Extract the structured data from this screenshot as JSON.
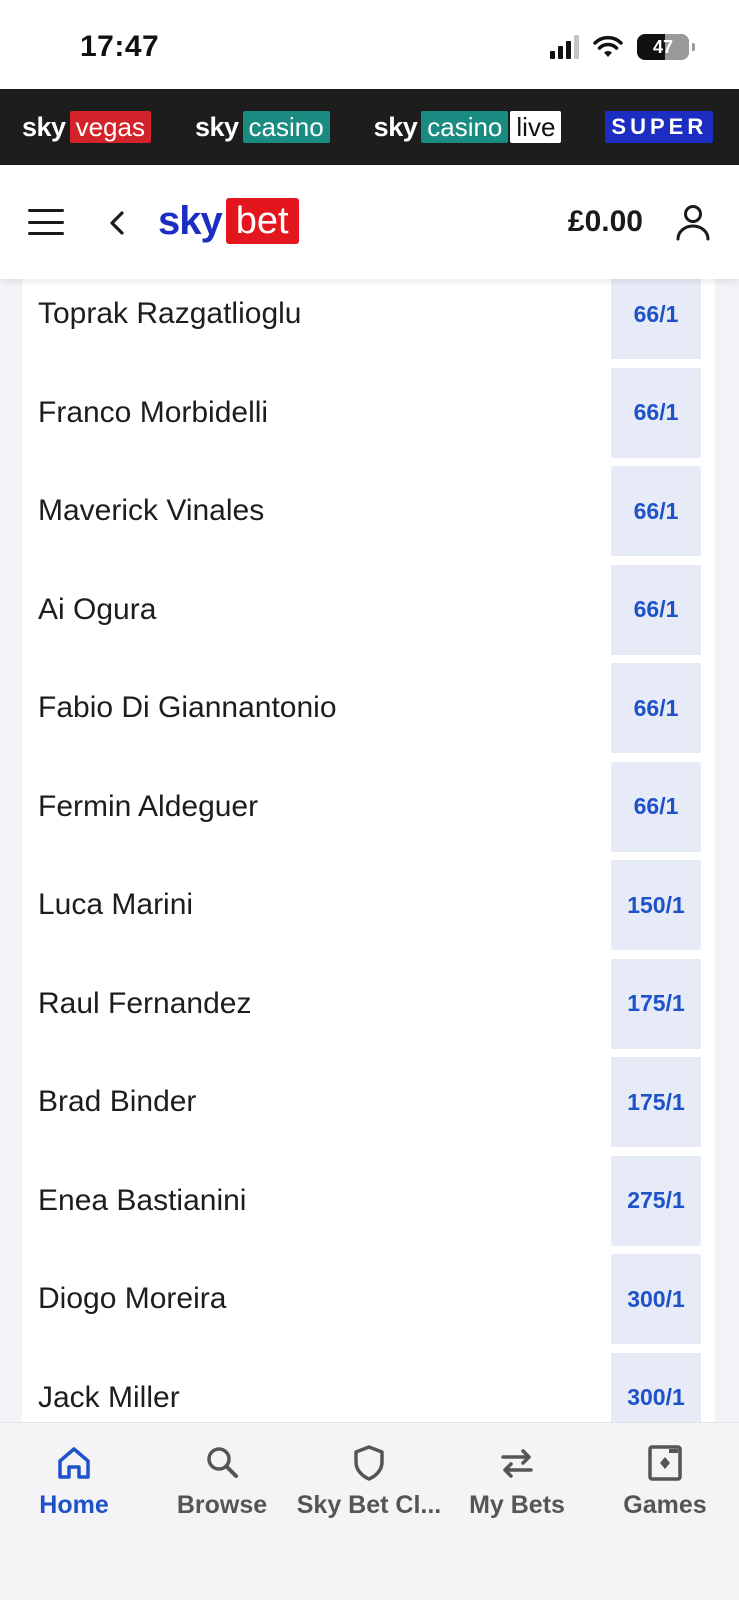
{
  "status_bar": {
    "time": "17:47",
    "battery": "47"
  },
  "brand_strip": {
    "items": [
      {
        "sky": "sky",
        "tag": "vegas"
      },
      {
        "sky": "sky",
        "tag": "casino"
      },
      {
        "sky": "sky",
        "tag": "casino",
        "extra": "live"
      },
      {
        "tag": "SUPER"
      }
    ]
  },
  "header": {
    "logo_sky": "sky",
    "logo_bet": "bet",
    "balance": "£0.00"
  },
  "runners": [
    {
      "name": "Toprak Razgatlioglu",
      "odds": "66/1"
    },
    {
      "name": "Franco Morbidelli",
      "odds": "66/1"
    },
    {
      "name": "Maverick Vinales",
      "odds": "66/1"
    },
    {
      "name": "Ai Ogura",
      "odds": "66/1"
    },
    {
      "name": "Fabio Di Giannantonio",
      "odds": "66/1"
    },
    {
      "name": "Fermin Aldeguer",
      "odds": "66/1"
    },
    {
      "name": "Luca Marini",
      "odds": "150/1"
    },
    {
      "name": "Raul Fernandez",
      "odds": "175/1"
    },
    {
      "name": "Brad Binder",
      "odds": "175/1"
    },
    {
      "name": "Enea Bastianini",
      "odds": "275/1"
    },
    {
      "name": "Diogo Moreira",
      "odds": "300/1"
    },
    {
      "name": "Jack Miller",
      "odds": "300/1"
    }
  ],
  "bottom_nav": {
    "items": [
      {
        "label": "Home",
        "icon": "home-icon",
        "active": true
      },
      {
        "label": "Browse",
        "icon": "search-icon",
        "active": false
      },
      {
        "label": "Sky Bet Cl...",
        "icon": "shield-icon",
        "active": false
      },
      {
        "label": "My Bets",
        "icon": "swap-arrows-icon",
        "active": false
      },
      {
        "label": "Games",
        "icon": "games-card-icon",
        "active": false
      }
    ]
  },
  "colors": {
    "accent_blue": "#1e52c8",
    "odds_bg": "#e6ebf7",
    "sky_red": "#e2161c",
    "sky_blue": "#1c2ec2",
    "strip_bg": "#1d1d1d"
  }
}
